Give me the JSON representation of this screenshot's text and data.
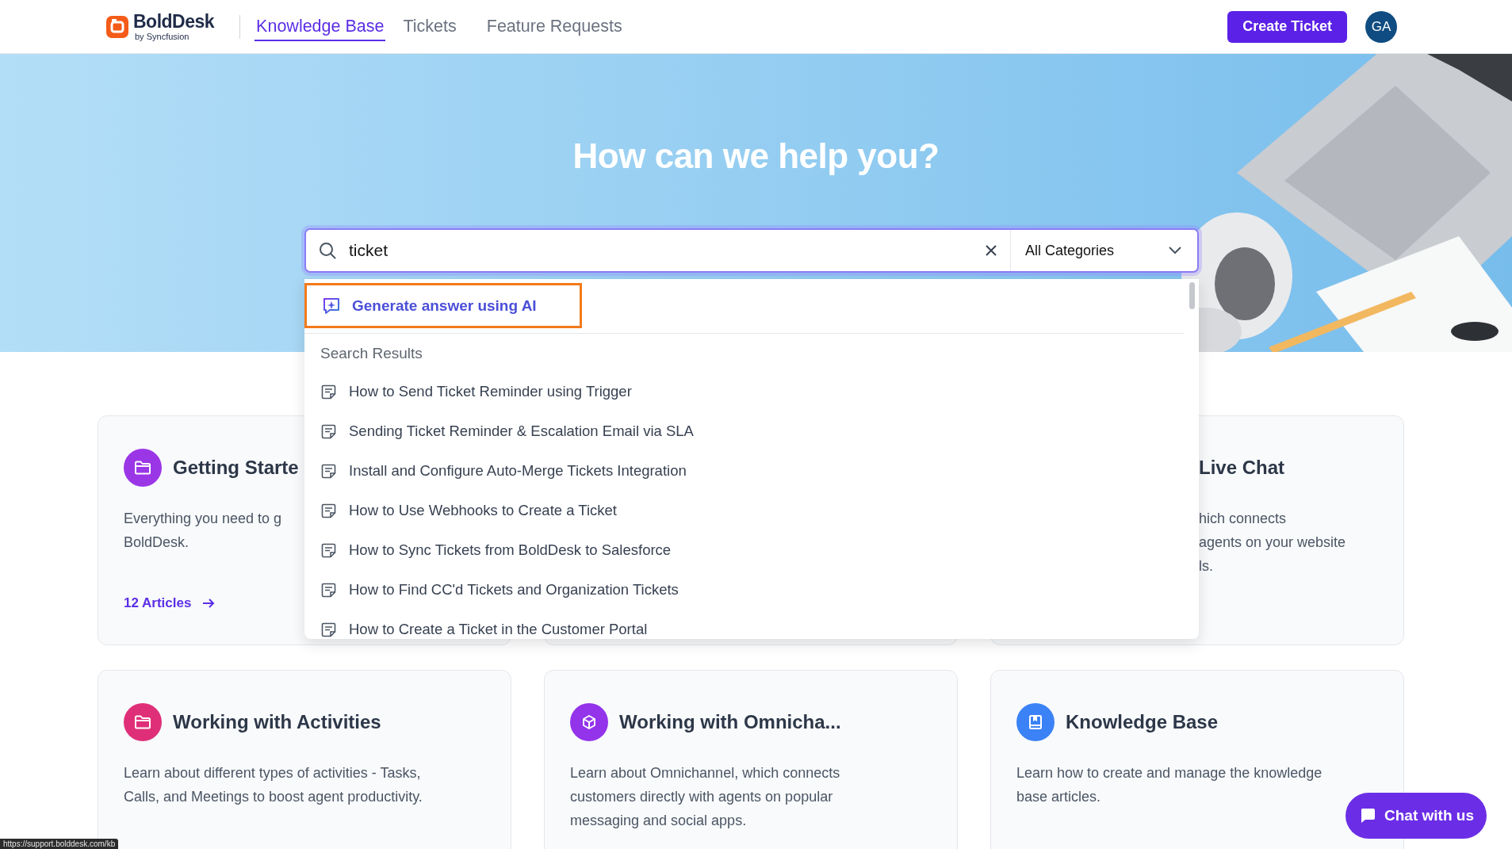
{
  "header": {
    "logo": {
      "name": "BoldDesk",
      "tagline": "by Syncfusion"
    },
    "nav": [
      {
        "label": "Knowledge Base",
        "selected": true
      },
      {
        "label": "Tickets",
        "selected": false
      },
      {
        "label": "Feature Requests",
        "selected": false
      }
    ],
    "create_button": "Create Ticket",
    "avatar": "GA"
  },
  "hero": {
    "title": "How can we help you?",
    "search": {
      "value": "ticket",
      "category": "All Categories"
    }
  },
  "search_dropdown": {
    "ai_action": "Generate answer using AI",
    "heading": "Search Results",
    "results": [
      "How to Send Ticket Reminder using Trigger",
      "Sending Ticket Reminder & Escalation Email via SLA",
      "Install and Configure Auto-Merge Tickets Integration",
      "How to Use Webhooks to Create a Ticket",
      "How to Sync Tickets from BoldDesk to Salesforce",
      "How to Find CC'd Tickets and Organization Tickets",
      "How to Create a Ticket in the Customer Portal"
    ]
  },
  "cards": [
    {
      "kind": "partial_left",
      "color": "#9b36e6",
      "title": "Getting Starte",
      "description_lines": [
        "Everything you need to g",
        "BoldDesk."
      ],
      "link": "12 Articles"
    },
    {
      "kind": "covered"
    },
    {
      "kind": "partial_right",
      "title": "Live Chat",
      "description_lines": [
        "hich connects",
        "agents on your website",
        "ls."
      ]
    },
    {
      "kind": "full",
      "color": "#df2f78",
      "title": "Working with Activities",
      "description_lines": [
        "Learn about different types of activities - Tasks,",
        "Calls, and Meetings to boost agent productivity."
      ]
    },
    {
      "kind": "full",
      "color": "#9333ea",
      "title": "Working with Omnicha...",
      "description_lines": [
        "Learn about Omnichannel, which connects",
        "customers directly with agents on popular",
        "messaging and social apps."
      ]
    },
    {
      "kind": "full",
      "color": "#3b82f6",
      "title": "Knowledge Base",
      "description_lines": [
        "Learn how to create and manage the knowledge",
        "base articles."
      ]
    }
  ],
  "chat_button": "Chat with us",
  "status_url": "https://support.bolddesk.com/kb"
}
